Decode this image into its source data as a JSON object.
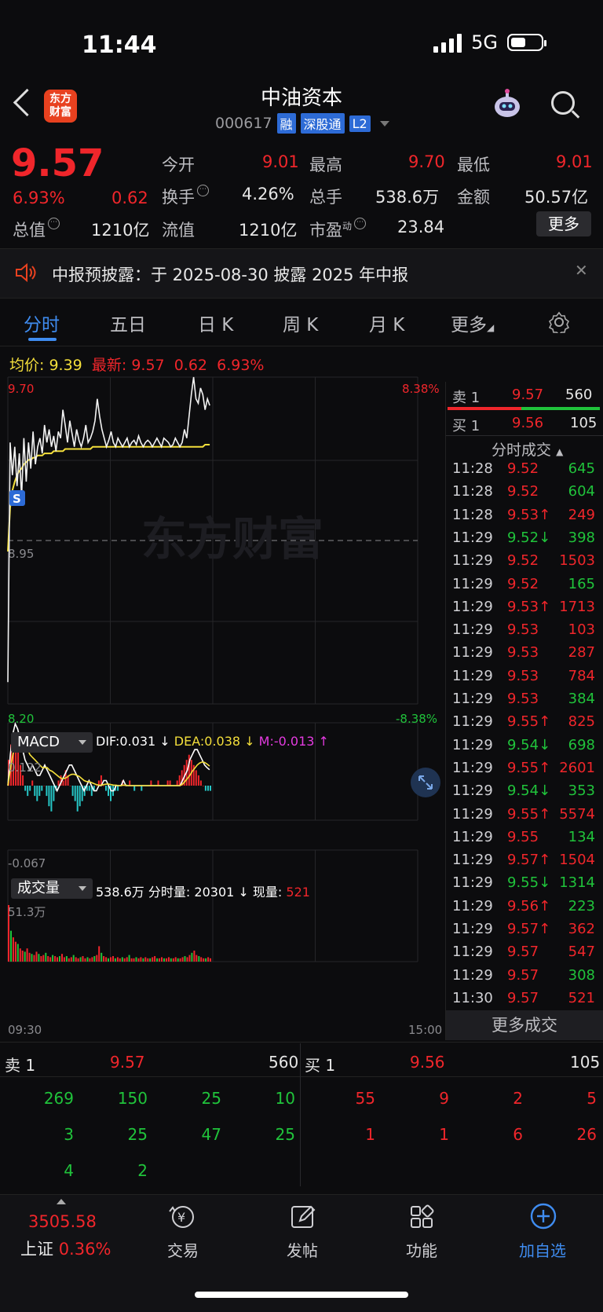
{
  "status": {
    "time": "11:44",
    "network": "5G"
  },
  "header": {
    "logo_line1": "东方",
    "logo_line2": "财富",
    "title": "中油资本",
    "code": "000617",
    "tags": [
      "融",
      "深股通",
      "L2"
    ]
  },
  "quote": {
    "price": "9.57",
    "change_pct": "6.93%",
    "change": "0.62",
    "open_label": "今开",
    "open": "9.01",
    "high_label": "最高",
    "high": "9.70",
    "low_label": "最低",
    "low": "9.01",
    "turnover_label": "换手",
    "turnover": "4.26%",
    "volume_label": "总手",
    "volume": "538.6万",
    "amount_label": "金额",
    "amount": "50.57亿",
    "mcap_label": "总值",
    "mcap": "1210亿",
    "float_label": "流值",
    "float": "1210亿",
    "pe_label": "市盈",
    "pe_sup": "动",
    "pe": "23.84",
    "more_label": "更多"
  },
  "notice": {
    "text": "中报预披露：于 2025-08-30 披露 2025 年中报"
  },
  "tabs": [
    "分时",
    "五日",
    "日 K",
    "周 K",
    "月 K",
    "更多"
  ],
  "priceline": {
    "avg_label": "均价:",
    "avg": "9.39",
    "latest_label": "最新:",
    "latest": "9.57",
    "chg": "0.62",
    "pct": "6.93%"
  },
  "chart_data": {
    "type": "line",
    "y_range": [
      8.2,
      9.7
    ],
    "y_labels": {
      "top": "9.70",
      "mid": "8.95",
      "bottom": "8.20",
      "top_pct": "8.38%",
      "bottom_pct": "-8.38%"
    },
    "x_labels": {
      "start": "09:30",
      "end": "15:00"
    },
    "price_series": [
      8.3,
      9.4,
      9.25,
      9.38,
      9.2,
      9.35,
      9.15,
      9.42,
      9.22,
      9.4,
      9.28,
      9.45,
      9.3,
      9.38,
      9.42,
      9.35,
      9.48,
      9.4,
      9.46,
      9.38,
      9.43,
      9.36,
      9.45,
      9.42,
      9.55,
      9.48,
      9.4,
      9.5,
      9.44,
      9.38,
      9.46,
      9.41,
      9.38,
      9.42,
      9.48,
      9.4,
      9.42,
      9.45,
      9.5,
      9.6,
      9.52,
      9.46,
      9.42,
      9.38,
      9.41,
      9.45,
      9.4,
      9.38,
      9.42,
      9.4,
      9.38,
      9.4,
      9.42,
      9.38,
      9.4,
      9.41,
      9.39,
      9.43,
      9.4,
      9.38,
      9.4,
      9.41,
      9.4,
      9.38,
      9.4,
      9.42,
      9.4,
      9.38,
      9.42,
      9.41,
      9.4,
      9.38,
      9.39,
      9.42,
      9.4,
      9.38,
      9.4,
      9.46,
      9.42,
      9.52,
      9.62,
      9.7,
      9.6,
      9.58,
      9.65,
      9.62,
      9.55,
      9.6,
      9.57
    ],
    "avg_series": [
      8.9,
      9.1,
      9.18,
      9.22,
      9.25,
      9.27,
      9.28,
      9.3,
      9.31,
      9.32,
      9.32,
      9.33,
      9.33,
      9.34,
      9.34,
      9.34,
      9.35,
      9.35,
      9.35,
      9.35,
      9.36,
      9.36,
      9.36,
      9.36,
      9.36,
      9.37,
      9.37,
      9.37,
      9.37,
      9.37,
      9.37,
      9.37,
      9.37,
      9.37,
      9.37,
      9.37,
      9.37,
      9.38,
      9.38,
      9.38,
      9.38,
      9.38,
      9.38,
      9.38,
      9.38,
      9.38,
      9.38,
      9.38,
      9.38,
      9.38,
      9.38,
      9.38,
      9.38,
      9.38,
      9.38,
      9.38,
      9.38,
      9.38,
      9.38,
      9.38,
      9.38,
      9.38,
      9.38,
      9.38,
      9.38,
      9.38,
      9.38,
      9.38,
      9.38,
      9.38,
      9.38,
      9.38,
      9.38,
      9.38,
      9.38,
      9.38,
      9.38,
      9.38,
      9.38,
      9.38,
      9.38,
      9.38,
      9.38,
      9.38,
      9.38,
      9.38,
      9.39,
      9.39,
      9.39
    ],
    "macd": {
      "label": "MACD",
      "dif": "DIF:0.031 ↓",
      "dea": "DEA:0.038 ↓",
      "m": "M:-0.013 ↑",
      "top": "0.122",
      "bottom": "-0.067",
      "hist": [
        0.05,
        0.08,
        0.1,
        0.09,
        0.07,
        0.04,
        0.02,
        -0.01,
        -0.02,
        -0.01,
        0.01,
        -0.02,
        -0.03,
        -0.02,
        -0.01,
        0.0,
        -0.02,
        -0.04,
        -0.05,
        -0.03,
        -0.01,
        0.01,
        0.02,
        0.01,
        0.03,
        0.02,
        0.0,
        -0.02,
        -0.03,
        -0.05,
        -0.04,
        -0.03,
        -0.02,
        -0.01,
        -0.01,
        -0.02,
        -0.01,
        0.0,
        0.01,
        0.02,
        0.0,
        -0.01,
        -0.02,
        -0.03,
        -0.02,
        -0.01,
        -0.01,
        0.0,
        0.01,
        0.0,
        0.0,
        0.01,
        0.0,
        -0.01,
        0.0,
        0.0,
        -0.01,
        0.0,
        0.0,
        0.0,
        0.01,
        0.0,
        0.0,
        0.01,
        0.0,
        0.0,
        0.0,
        0.01,
        0.01,
        0.0,
        0.0,
        0.01,
        0.02,
        0.03,
        0.04,
        0.05,
        0.06,
        0.05,
        0.04,
        0.03,
        0.02,
        0.01,
        0.0,
        -0.01,
        -0.01,
        -0.01
      ],
      "dif_series": [
        0.0,
        0.06,
        0.1,
        0.12,
        0.11,
        0.09,
        0.07,
        0.05,
        0.04,
        0.03,
        0.04,
        0.03,
        0.02,
        0.02,
        0.03,
        0.04,
        0.03,
        0.02,
        0.01,
        0.0,
        -0.01,
        0.0,
        0.01,
        0.02,
        0.03,
        0.04,
        0.04,
        0.03,
        0.02,
        0.01,
        0.0,
        -0.01,
        0.0,
        0.01,
        0.0,
        -0.01,
        -0.01,
        0.0,
        0.0,
        0.01,
        0.01,
        0.0,
        -0.01,
        -0.01,
        0.0,
        0.0,
        0.0,
        0.01,
        0.0,
        0.0,
        0.0,
        0.0,
        0.0,
        0.0,
        0.0,
        0.0,
        0.0,
        0.0,
        0.0,
        0.0,
        0.0,
        0.0,
        0.0,
        0.0,
        0.0,
        0.0,
        0.0,
        0.0,
        0.0,
        0.0,
        0.0,
        0.01,
        0.02,
        0.03,
        0.05,
        0.06,
        0.07,
        0.07,
        0.06,
        0.05,
        0.04,
        0.035,
        0.031
      ],
      "dea_series": [
        0.0,
        0.03,
        0.06,
        0.08,
        0.09,
        0.09,
        0.085,
        0.08,
        0.07,
        0.06,
        0.055,
        0.05,
        0.045,
        0.04,
        0.035,
        0.035,
        0.035,
        0.03,
        0.028,
        0.024,
        0.02,
        0.016,
        0.014,
        0.014,
        0.016,
        0.02,
        0.022,
        0.022,
        0.02,
        0.018,
        0.014,
        0.01,
        0.008,
        0.008,
        0.006,
        0.004,
        0.002,
        0.001,
        0.001,
        0.002,
        0.003,
        0.003,
        0.002,
        0.001,
        0.001,
        0.0,
        0.0,
        0.001,
        0.001,
        0.0,
        0.0,
        0.0,
        0.0,
        0.0,
        0.0,
        0.0,
        0.0,
        0.0,
        0.0,
        0.0,
        0.0,
        0.0,
        0.0,
        0.0,
        0.0,
        0.0,
        0.0,
        0.0,
        0.0,
        0.0,
        0.0,
        0.003,
        0.008,
        0.014,
        0.02,
        0.028,
        0.034,
        0.04,
        0.044,
        0.046,
        0.045,
        0.042,
        0.038
      ]
    },
    "volume": {
      "label": "成交量",
      "total": "538.6万",
      "period_label": "分时量:",
      "period": "20301",
      "now_label": "现量:",
      "now": "521",
      "max": "51.3万",
      "bars": [
        51.3,
        28,
        22,
        18,
        16,
        12,
        10,
        9,
        12,
        8,
        7,
        6,
        9,
        7,
        5,
        6,
        8,
        5,
        4,
        6,
        5,
        4,
        5,
        7,
        4,
        5,
        3,
        4,
        6,
        4,
        3,
        4,
        5,
        3,
        4,
        3,
        4,
        5,
        6,
        14,
        8,
        5,
        4,
        3,
        4,
        5,
        3,
        4,
        3,
        4,
        3,
        4,
        6,
        3,
        3,
        4,
        3,
        4,
        3,
        4,
        3,
        3,
        4,
        5,
        3,
        3,
        4,
        3,
        3,
        4,
        3,
        3,
        4,
        3,
        3,
        4,
        5,
        4,
        6,
        8,
        10,
        6,
        5,
        4,
        3,
        3,
        4,
        3
      ]
    }
  },
  "book_top": {
    "ask_label": "卖 1",
    "ask_price": "9.57",
    "ask_vol": "560",
    "bid_label": "买 1",
    "bid_price": "9.56",
    "bid_vol": "105"
  },
  "ticks_title": "分时成交",
  "ticks": [
    {
      "t": "11:28",
      "p": "9.52",
      "v": "645",
      "d": "",
      "vc": "green"
    },
    {
      "t": "11:28",
      "p": "9.52",
      "v": "604",
      "d": "",
      "vc": "green"
    },
    {
      "t": "11:28",
      "p": "9.53",
      "v": "249",
      "d": "↑",
      "vc": "red"
    },
    {
      "t": "11:29",
      "p": "9.52",
      "v": "398",
      "d": "↓",
      "vc": "green"
    },
    {
      "t": "11:29",
      "p": "9.52",
      "v": "1503",
      "d": "",
      "vc": "red"
    },
    {
      "t": "11:29",
      "p": "9.52",
      "v": "165",
      "d": "",
      "vc": "green"
    },
    {
      "t": "11:29",
      "p": "9.53",
      "v": "1713",
      "d": "↑",
      "vc": "red"
    },
    {
      "t": "11:29",
      "p": "9.53",
      "v": "103",
      "d": "",
      "vc": "red"
    },
    {
      "t": "11:29",
      "p": "9.53",
      "v": "287",
      "d": "",
      "vc": "red"
    },
    {
      "t": "11:29",
      "p": "9.53",
      "v": "784",
      "d": "",
      "vc": "red"
    },
    {
      "t": "11:29",
      "p": "9.53",
      "v": "384",
      "d": "",
      "vc": "green"
    },
    {
      "t": "11:29",
      "p": "9.55",
      "v": "825",
      "d": "↑",
      "vc": "red"
    },
    {
      "t": "11:29",
      "p": "9.54",
      "v": "698",
      "d": "↓",
      "vc": "green"
    },
    {
      "t": "11:29",
      "p": "9.55",
      "v": "2601",
      "d": "↑",
      "vc": "red"
    },
    {
      "t": "11:29",
      "p": "9.54",
      "v": "353",
      "d": "↓",
      "vc": "green"
    },
    {
      "t": "11:29",
      "p": "9.55",
      "v": "5574",
      "d": "↑",
      "vc": "red"
    },
    {
      "t": "11:29",
      "p": "9.55",
      "v": "134",
      "d": "",
      "vc": "green"
    },
    {
      "t": "11:29",
      "p": "9.57",
      "v": "1504",
      "d": "↑",
      "vc": "red"
    },
    {
      "t": "11:29",
      "p": "9.55",
      "v": "1314",
      "d": "↓",
      "vc": "green"
    },
    {
      "t": "11:29",
      "p": "9.56",
      "v": "223",
      "d": "↑",
      "vc": "green"
    },
    {
      "t": "11:29",
      "p": "9.57",
      "v": "362",
      "d": "↑",
      "vc": "red"
    },
    {
      "t": "11:29",
      "p": "9.57",
      "v": "547",
      "d": "",
      "vc": "red"
    },
    {
      "t": "11:29",
      "p": "9.57",
      "v": "308",
      "d": "",
      "vc": "green"
    },
    {
      "t": "11:30",
      "p": "9.57",
      "v": "521",
      "d": "",
      "vc": "red"
    }
  ],
  "more_trades": "更多成交",
  "orderbook": {
    "ask_label": "卖 1",
    "ask_price": "9.57",
    "ask_vol": "560",
    "bid_label": "买 1",
    "bid_price": "9.56",
    "bid_vol": "105",
    "ask_queue": [
      [
        "269",
        "150",
        "25",
        "10"
      ],
      [
        "3",
        "25",
        "47",
        "25"
      ],
      [
        "4",
        "2",
        "",
        ""
      ]
    ],
    "bid_queue": [
      [
        "55",
        "9",
        "2",
        "5"
      ],
      [
        "1",
        "1",
        "6",
        "26"
      ]
    ]
  },
  "nav": {
    "index_value": "3505.58",
    "index_name": "上证",
    "index_pct": "0.36%",
    "items": [
      "交易",
      "发帖",
      "功能",
      "加自选"
    ]
  },
  "watermark": "东方财富",
  "colors": {
    "up": "#f0262b",
    "down": "#20c33b",
    "accent": "#3f8cf0",
    "avg": "#f4df3b"
  }
}
